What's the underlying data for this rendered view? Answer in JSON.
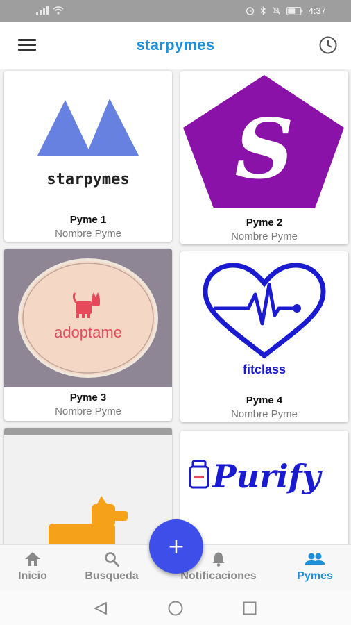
{
  "status_bar": {
    "time": "4:37"
  },
  "app_bar": {
    "title": "starpymes"
  },
  "cards": [
    {
      "name": "Pyme 1",
      "subtitle": "Nombre Pyme",
      "logo_text": "starpymes"
    },
    {
      "name": "Pyme 2",
      "subtitle": "Nombre Pyme",
      "logo_text": "S"
    },
    {
      "name": "Pyme 3",
      "subtitle": "Nombre Pyme",
      "logo_text": "adoptame"
    },
    {
      "name": "Pyme 4",
      "subtitle": "Nombre Pyme",
      "logo_text": "fitclass"
    },
    {
      "name": "",
      "subtitle": "",
      "logo_text": ""
    },
    {
      "name": "",
      "subtitle": "",
      "logo_text": "Purify"
    }
  ],
  "fab": {
    "label": "+"
  },
  "bottom_nav": {
    "items": [
      {
        "label": "Inicio",
        "icon": "home-icon"
      },
      {
        "label": "Busqueda",
        "icon": "search-icon"
      },
      {
        "label": "Notificaciones",
        "icon": "bell-icon"
      },
      {
        "label": "Pymes",
        "icon": "group-icon"
      }
    ],
    "active_index": 3
  },
  "colors": {
    "accent": "#1e8fd8",
    "fab": "#3d4fe8",
    "nav_inactive": "#8a8a8a"
  }
}
